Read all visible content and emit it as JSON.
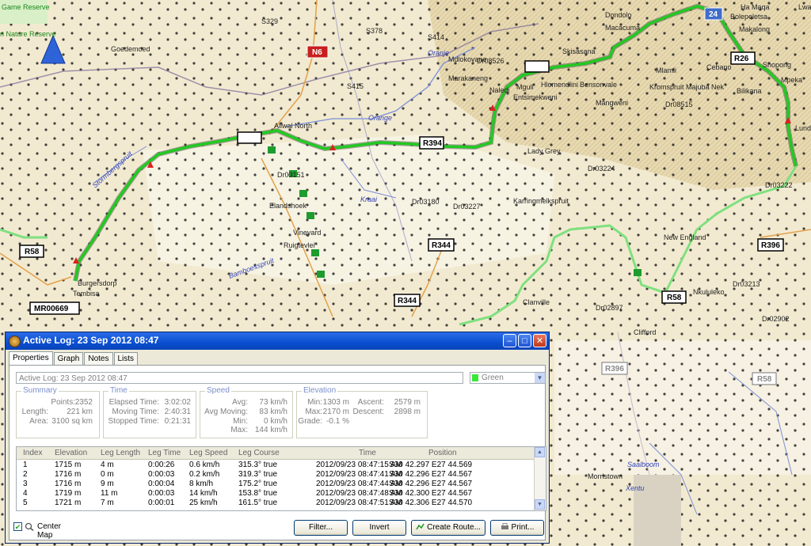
{
  "window": {
    "title": "Active Log: 23 Sep 2012 08:47",
    "minimize_glyph": "–",
    "maximize_glyph": "□",
    "close_glyph": "✕"
  },
  "tabs": [
    "Properties",
    "Graph",
    "Notes",
    "Lists"
  ],
  "log_name_value": "Active Log: 23 Sep 2012 08:47",
  "color_select": {
    "value": "Green",
    "swatch": "#38e838"
  },
  "summary": {
    "title": "Summary",
    "points_label": "Points:",
    "points": "2352",
    "length_label": "Length:",
    "length": "221 km",
    "area_label": "Area:",
    "area": "3100 sq km"
  },
  "time": {
    "title": "Time",
    "elapsed_label": "Elapsed Time:",
    "elapsed": "3:02:02",
    "moving_label": "Moving Time:",
    "moving": "2:40:31",
    "stopped_label": "Stopped Time:",
    "stopped": "0:21:31"
  },
  "speed": {
    "title": "Speed",
    "avg_label": "Avg:",
    "avg": "73 km/h",
    "avg_moving_label": "Avg Moving:",
    "avg_moving": "83 km/h",
    "min_label": "Min:",
    "min": "0 km/h",
    "max_label": "Max:",
    "max": "144 km/h"
  },
  "elevation": {
    "title": "Elevation",
    "min_label": "Min:",
    "min": "1303 m",
    "max_label": "Max:",
    "max": "2170 m",
    "grade_label": "Grade:",
    "grade": "-0.1 %",
    "ascent_label": "Ascent:",
    "ascent": "2579 m",
    "descent_label": "Descent:",
    "descent": "2898 m"
  },
  "table": {
    "headers": [
      "Index",
      "Elevation",
      "Leg Length",
      "Leg Time",
      "Leg Speed",
      "Leg Course",
      "Time",
      "Position"
    ],
    "rows": [
      [
        "1",
        "1715 m",
        "4 m",
        "0:00:26",
        "0.6 km/h",
        "315.3° true",
        "2012/09/23 08:47:15 AM",
        "S30 42.297 E27 44.569"
      ],
      [
        "2",
        "1716 m",
        "0 m",
        "0:00:03",
        "0.2 km/h",
        "319.3° true",
        "2012/09/23 08:47:41 AM",
        "S30 42.296 E27 44.567"
      ],
      [
        "3",
        "1716 m",
        "9 m",
        "0:00:04",
        "8 km/h",
        "175.2° true",
        "2012/09/23 08:47:44 AM",
        "S30 42.296 E27 44.567"
      ],
      [
        "4",
        "1719 m",
        "11 m",
        "0:00:03",
        "14 km/h",
        "153.8° true",
        "2012/09/23 08:47:48 AM",
        "S30 42.300 E27 44.567"
      ],
      [
        "5",
        "1721 m",
        "7 m",
        "0:00:01",
        "25 km/h",
        "161.5° true",
        "2012/09/23 08:47:51 AM",
        "S30 42.306 E27 44.570"
      ]
    ]
  },
  "center_map": {
    "label": "Center Map",
    "checked": "✔"
  },
  "buttons": {
    "filter": "Filter...",
    "invert": "Invert",
    "create_route": "Create Route...",
    "print": "Print..."
  },
  "scroll": {
    "up": "▲",
    "down": "▼"
  },
  "map": {
    "labels": {
      "game_reserve": "Game Reserve",
      "nature_reserve": "n Nature Reserve",
      "goedemoed": "Goedemoed",
      "aliwal_north": "Aliwal North",
      "burgersdorp": "Burgersdorp",
      "tembisa": "Tembisa",
      "elandshoek": "Elandshoek",
      "vineyard": "Vineyard",
      "ruigtevlei": "Ruigtevlei",
      "lady_grey": "Lady Grey",
      "karringmelkspruit": "Karringmelkspruit",
      "clanville": "Clanville",
      "new_england": "New England",
      "clifford": "Clifford",
      "morristown": "Morristown",
      "mlamli": "Mlamli",
      "mangweni": "Mangweni",
      "bensonvale": "Bensonvale",
      "hlomendlini": "Hlomendlini",
      "mguli": "Mguli",
      "naledi": "Naledi",
      "entsimekweni": "Entsimekweni",
      "marakaneng": "Marakaneng",
      "mdlokovane": "Mdlokovane",
      "sirkasana": "Skisasana",
      "macacuma": "Macacuma",
      "dondolo": "Dondolo",
      "cebano": "Cebano",
      "shopong": "Shopong",
      "mpeka": "Mpeka",
      "bilikana": "Bilikana",
      "majuba_nek": "Majuba Nek",
      "kromspruit": "Kromspruit",
      "ha_maqa": "Ha Maqa",
      "bolepeletsa": "Bolepeletsa",
      "makalong": "Makalong",
      "lundi": "Lundi",
      "nkululeko": "Nkululeko",
      "orange_river": "Orange",
      "oranje": "Oranje",
      "kraai": "Kraai",
      "stormbergspruit": "Stormbergspruit",
      "bamboesspruit": "Bamboesspruit",
      "saalboom": "Saalboom",
      "xentu": "Xentu",
      "dr0526": "Dr08526",
      "dr03151": "Dr03151",
      "dr03180": "Dr03180",
      "dr03227": "Dr03227",
      "dr03224": "Dr03224",
      "dr08515": "Dr08515",
      "dr03213": "Dr03213",
      "dr02897": "Dr02897",
      "dr02902": "Dr02902",
      "dr03222": "Dr03222",
      "s329": "S329",
      "s378": "S378",
      "s415": "S415",
      "s414": "S414",
      "lwa": "Lwa"
    },
    "shields": {
      "n6": "N6",
      "r58_w": "R58",
      "r58_s": "R58",
      "r58_e": "R58",
      "r344_a": "R344",
      "r344_b": "R344",
      "r396_a": "R396",
      "r396_b": "R396",
      "mr": "MR00669",
      "r26": "R26",
      "r394": "R394",
      "x24": "24"
    }
  }
}
